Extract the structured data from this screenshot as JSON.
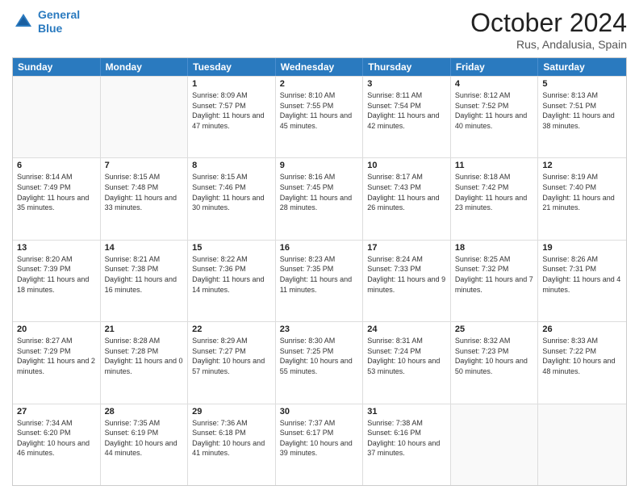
{
  "header": {
    "logo_line1": "General",
    "logo_line2": "Blue",
    "month": "October 2024",
    "location": "Rus, Andalusia, Spain"
  },
  "days_of_week": [
    "Sunday",
    "Monday",
    "Tuesday",
    "Wednesday",
    "Thursday",
    "Friday",
    "Saturday"
  ],
  "weeks": [
    [
      {
        "day": "",
        "sunrise": "",
        "sunset": "",
        "daylight": ""
      },
      {
        "day": "",
        "sunrise": "",
        "sunset": "",
        "daylight": ""
      },
      {
        "day": "1",
        "sunrise": "Sunrise: 8:09 AM",
        "sunset": "Sunset: 7:57 PM",
        "daylight": "Daylight: 11 hours and 47 minutes."
      },
      {
        "day": "2",
        "sunrise": "Sunrise: 8:10 AM",
        "sunset": "Sunset: 7:55 PM",
        "daylight": "Daylight: 11 hours and 45 minutes."
      },
      {
        "day": "3",
        "sunrise": "Sunrise: 8:11 AM",
        "sunset": "Sunset: 7:54 PM",
        "daylight": "Daylight: 11 hours and 42 minutes."
      },
      {
        "day": "4",
        "sunrise": "Sunrise: 8:12 AM",
        "sunset": "Sunset: 7:52 PM",
        "daylight": "Daylight: 11 hours and 40 minutes."
      },
      {
        "day": "5",
        "sunrise": "Sunrise: 8:13 AM",
        "sunset": "Sunset: 7:51 PM",
        "daylight": "Daylight: 11 hours and 38 minutes."
      }
    ],
    [
      {
        "day": "6",
        "sunrise": "Sunrise: 8:14 AM",
        "sunset": "Sunset: 7:49 PM",
        "daylight": "Daylight: 11 hours and 35 minutes."
      },
      {
        "day": "7",
        "sunrise": "Sunrise: 8:15 AM",
        "sunset": "Sunset: 7:48 PM",
        "daylight": "Daylight: 11 hours and 33 minutes."
      },
      {
        "day": "8",
        "sunrise": "Sunrise: 8:15 AM",
        "sunset": "Sunset: 7:46 PM",
        "daylight": "Daylight: 11 hours and 30 minutes."
      },
      {
        "day": "9",
        "sunrise": "Sunrise: 8:16 AM",
        "sunset": "Sunset: 7:45 PM",
        "daylight": "Daylight: 11 hours and 28 minutes."
      },
      {
        "day": "10",
        "sunrise": "Sunrise: 8:17 AM",
        "sunset": "Sunset: 7:43 PM",
        "daylight": "Daylight: 11 hours and 26 minutes."
      },
      {
        "day": "11",
        "sunrise": "Sunrise: 8:18 AM",
        "sunset": "Sunset: 7:42 PM",
        "daylight": "Daylight: 11 hours and 23 minutes."
      },
      {
        "day": "12",
        "sunrise": "Sunrise: 8:19 AM",
        "sunset": "Sunset: 7:40 PM",
        "daylight": "Daylight: 11 hours and 21 minutes."
      }
    ],
    [
      {
        "day": "13",
        "sunrise": "Sunrise: 8:20 AM",
        "sunset": "Sunset: 7:39 PM",
        "daylight": "Daylight: 11 hours and 18 minutes."
      },
      {
        "day": "14",
        "sunrise": "Sunrise: 8:21 AM",
        "sunset": "Sunset: 7:38 PM",
        "daylight": "Daylight: 11 hours and 16 minutes."
      },
      {
        "day": "15",
        "sunrise": "Sunrise: 8:22 AM",
        "sunset": "Sunset: 7:36 PM",
        "daylight": "Daylight: 11 hours and 14 minutes."
      },
      {
        "day": "16",
        "sunrise": "Sunrise: 8:23 AM",
        "sunset": "Sunset: 7:35 PM",
        "daylight": "Daylight: 11 hours and 11 minutes."
      },
      {
        "day": "17",
        "sunrise": "Sunrise: 8:24 AM",
        "sunset": "Sunset: 7:33 PM",
        "daylight": "Daylight: 11 hours and 9 minutes."
      },
      {
        "day": "18",
        "sunrise": "Sunrise: 8:25 AM",
        "sunset": "Sunset: 7:32 PM",
        "daylight": "Daylight: 11 hours and 7 minutes."
      },
      {
        "day": "19",
        "sunrise": "Sunrise: 8:26 AM",
        "sunset": "Sunset: 7:31 PM",
        "daylight": "Daylight: 11 hours and 4 minutes."
      }
    ],
    [
      {
        "day": "20",
        "sunrise": "Sunrise: 8:27 AM",
        "sunset": "Sunset: 7:29 PM",
        "daylight": "Daylight: 11 hours and 2 minutes."
      },
      {
        "day": "21",
        "sunrise": "Sunrise: 8:28 AM",
        "sunset": "Sunset: 7:28 PM",
        "daylight": "Daylight: 11 hours and 0 minutes."
      },
      {
        "day": "22",
        "sunrise": "Sunrise: 8:29 AM",
        "sunset": "Sunset: 7:27 PM",
        "daylight": "Daylight: 10 hours and 57 minutes."
      },
      {
        "day": "23",
        "sunrise": "Sunrise: 8:30 AM",
        "sunset": "Sunset: 7:25 PM",
        "daylight": "Daylight: 10 hours and 55 minutes."
      },
      {
        "day": "24",
        "sunrise": "Sunrise: 8:31 AM",
        "sunset": "Sunset: 7:24 PM",
        "daylight": "Daylight: 10 hours and 53 minutes."
      },
      {
        "day": "25",
        "sunrise": "Sunrise: 8:32 AM",
        "sunset": "Sunset: 7:23 PM",
        "daylight": "Daylight: 10 hours and 50 minutes."
      },
      {
        "day": "26",
        "sunrise": "Sunrise: 8:33 AM",
        "sunset": "Sunset: 7:22 PM",
        "daylight": "Daylight: 10 hours and 48 minutes."
      }
    ],
    [
      {
        "day": "27",
        "sunrise": "Sunrise: 7:34 AM",
        "sunset": "Sunset: 6:20 PM",
        "daylight": "Daylight: 10 hours and 46 minutes."
      },
      {
        "day": "28",
        "sunrise": "Sunrise: 7:35 AM",
        "sunset": "Sunset: 6:19 PM",
        "daylight": "Daylight: 10 hours and 44 minutes."
      },
      {
        "day": "29",
        "sunrise": "Sunrise: 7:36 AM",
        "sunset": "Sunset: 6:18 PM",
        "daylight": "Daylight: 10 hours and 41 minutes."
      },
      {
        "day": "30",
        "sunrise": "Sunrise: 7:37 AM",
        "sunset": "Sunset: 6:17 PM",
        "daylight": "Daylight: 10 hours and 39 minutes."
      },
      {
        "day": "31",
        "sunrise": "Sunrise: 7:38 AM",
        "sunset": "Sunset: 6:16 PM",
        "daylight": "Daylight: 10 hours and 37 minutes."
      },
      {
        "day": "",
        "sunrise": "",
        "sunset": "",
        "daylight": ""
      },
      {
        "day": "",
        "sunrise": "",
        "sunset": "",
        "daylight": ""
      }
    ]
  ]
}
